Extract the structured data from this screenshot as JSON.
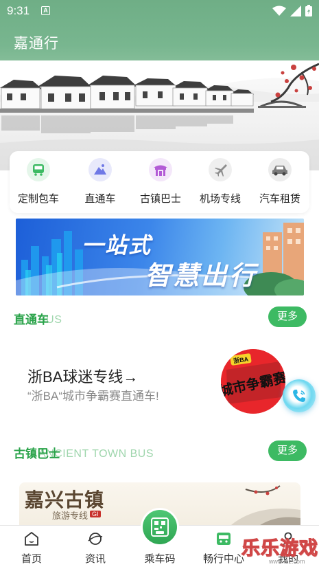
{
  "status_bar": {
    "time": "9:31",
    "notification": "A"
  },
  "app": {
    "title": "嘉通行"
  },
  "services": [
    {
      "label": "定制包车",
      "icon": "bus-icon",
      "color": "#3dba63",
      "bg": "#e5f6ea"
    },
    {
      "label": "直通车",
      "icon": "mountain-icon",
      "color": "#6f78e6",
      "bg": "#e8e9fb"
    },
    {
      "label": "古镇巴士",
      "icon": "pavilion-icon",
      "color": "#b35ad6",
      "bg": "#f4e7fa"
    },
    {
      "label": "机场专线",
      "icon": "airplane-icon",
      "color": "#8d8d8d",
      "bg": "#efefef"
    },
    {
      "label": "汽车租赁",
      "icon": "car-icon",
      "color": "#7a7a7a",
      "bg": "#ececec"
    }
  ],
  "banner": {
    "line1": "一站式",
    "line2": "智慧出行"
  },
  "sections": {
    "direct": {
      "title": "直通车",
      "subtitle": "BUS",
      "more": "更多"
    },
    "town": {
      "title": "古镇巴士",
      "subtitle": "ANCIENT TOWN BUS",
      "more": "更多"
    }
  },
  "promo": {
    "title": "浙BA球迷专线→",
    "desc": "“浙BA“城市争霸赛直通车!",
    "logo_badge": "浙BA",
    "logo_text": "城市争霸赛"
  },
  "town_card": {
    "logo": "嘉兴古镇",
    "sub": "旅游专线",
    "tag": "GI"
  },
  "bottom_nav": [
    {
      "label": "首页",
      "icon": "home-icon"
    },
    {
      "label": "资讯",
      "icon": "planet-icon"
    },
    {
      "label": "乘车码",
      "icon": "qr-code-icon"
    },
    {
      "label": "畅行中心",
      "icon": "bus-card-icon"
    },
    {
      "label": "我的",
      "icon": "person-icon"
    }
  ],
  "watermark": {
    "text": "乐乐游戏",
    "sub": "www.dlz.com"
  },
  "colors": {
    "accent": "#3dba63",
    "header": "#78b68f"
  }
}
